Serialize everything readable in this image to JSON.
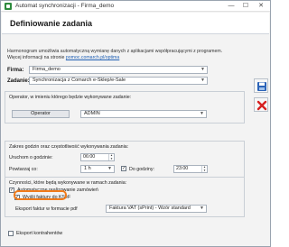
{
  "window": {
    "title": "Automat synchronizacji - Firma_demo",
    "minimize": "—",
    "maximize": "☐",
    "close": "✕"
  },
  "header": {
    "title": "Definiowanie zadania"
  },
  "intro": {
    "line1": "Harmonogram umożliwia automatyczną wymianę danych z aplikacjami współpracującymi z programem.",
    "line2_prefix": "Więcej informacji na stronie ",
    "link": "pomoc.comarch.pl/optima"
  },
  "form": {
    "firma_label": "Firma:",
    "firma_value": "Firma_demo",
    "zadanie_label": "Zadanie:",
    "zadanie_value": "Synchronizacja z Comarch e-Sklep/e-Sale"
  },
  "operator_group": {
    "title": "Operator, w imieniu którego będzie wykonywane zadanie:",
    "button": "Operator",
    "value": "ADMIN"
  },
  "time_group": {
    "title": "Zakres godzin oraz częstotliwość wykonywania zadania:",
    "start_label": "Uruchom o godzinie:",
    "start_value": "06:00",
    "repeat_label": "Powtarzaj co:",
    "repeat_value": "1 h",
    "until_label": "Do godziny:",
    "until_value": "23:00"
  },
  "actions_group": {
    "title": "Czynności, które będą wykonywane w ramach zadania:",
    "auto_orders_label": "Automatyczne realizowanie zamówień",
    "send_ksef_label": "Wyślij faktury do KSeF",
    "export_format_label": "Eksport faktur w formacie pdf",
    "export_format_value": "Faktura VAT (sPrint) - Wzór standard"
  },
  "export_contractors_label": "Eksport kontrahentów",
  "colors": {
    "highlight": "#f07a1a",
    "save": "#2b63b8",
    "cancel": "#d62020",
    "link": "#1f5fb3"
  },
  "icons": {
    "save": "save-icon",
    "cancel": "cancel-icon"
  }
}
